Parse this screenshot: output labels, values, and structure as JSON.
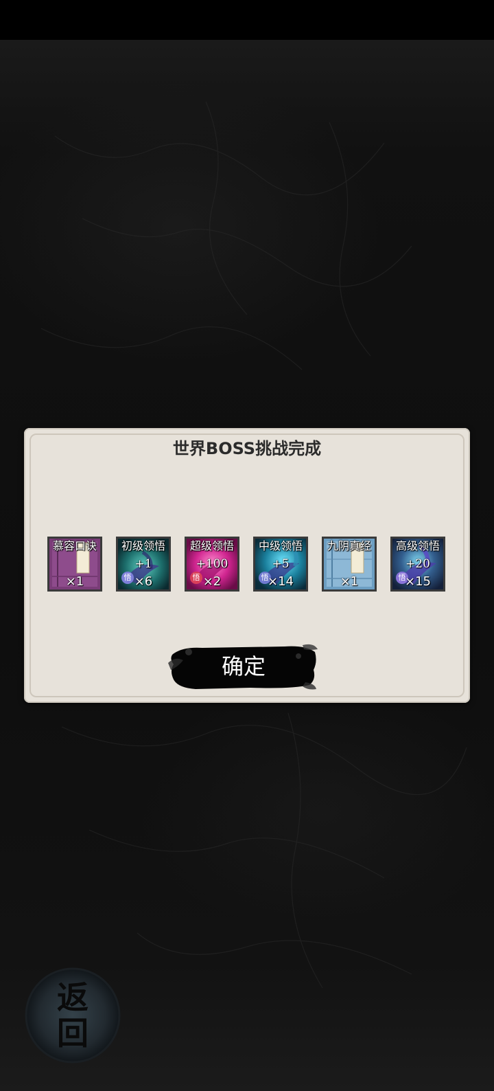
{
  "dialog": {
    "title": "世界BOSS挑战完成",
    "confirm_label": "确定"
  },
  "rewards": [
    {
      "name": "慕容口诀",
      "plus": "",
      "count": "×1",
      "badge": "",
      "theme": "purple-scroll"
    },
    {
      "name": "初级领悟",
      "plus": "+1",
      "count": "×6",
      "badge": "悟",
      "theme": "teal-orb"
    },
    {
      "name": "超级领悟",
      "plus": "+100",
      "count": "×2",
      "badge": "悟",
      "theme": "magenta-orb"
    },
    {
      "name": "中级领悟",
      "plus": "+5",
      "count": "×14",
      "badge": "悟",
      "theme": "cyan-orb"
    },
    {
      "name": "九阴真经",
      "plus": "",
      "count": "×1",
      "badge": "",
      "theme": "blue-scroll"
    },
    {
      "name": "高级领悟",
      "plus": "+20",
      "count": "×15",
      "badge": "悟",
      "theme": "violet-orb"
    }
  ],
  "back_button": {
    "label_line1": "返",
    "label_line2": "回"
  },
  "colors": {
    "background": "#0f0f0f",
    "dialog_bg": "#e7e2da",
    "title_text": "#2b2b2b",
    "button_ink": "#050505"
  }
}
